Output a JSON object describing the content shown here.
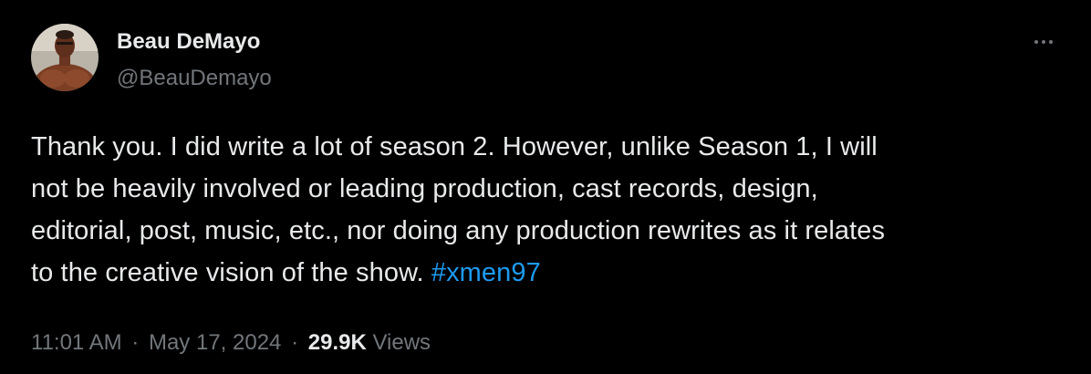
{
  "author": {
    "display_name": "Beau DeMayo",
    "handle": "@BeauDemayo"
  },
  "tweet": {
    "lines": [
      "Thank you. I did write a lot of season 2. However, unlike Season 1, I will",
      "not be heavily involved or leading production, cast records, design,",
      "editorial, post, music, etc., nor doing any production rewrites as it relates",
      "to the creative vision of the show. "
    ],
    "hashtag": "#xmen97"
  },
  "meta": {
    "time": "11:01 AM",
    "separator": "·",
    "date": "May 17, 2024",
    "views_count": "29.9K",
    "views_label": "Views"
  },
  "colors": {
    "background": "#000000",
    "text": "#e7e9ea",
    "muted": "#71767b",
    "link": "#1d9bf0"
  },
  "icons": {
    "more": "more-horizontal-icon"
  }
}
